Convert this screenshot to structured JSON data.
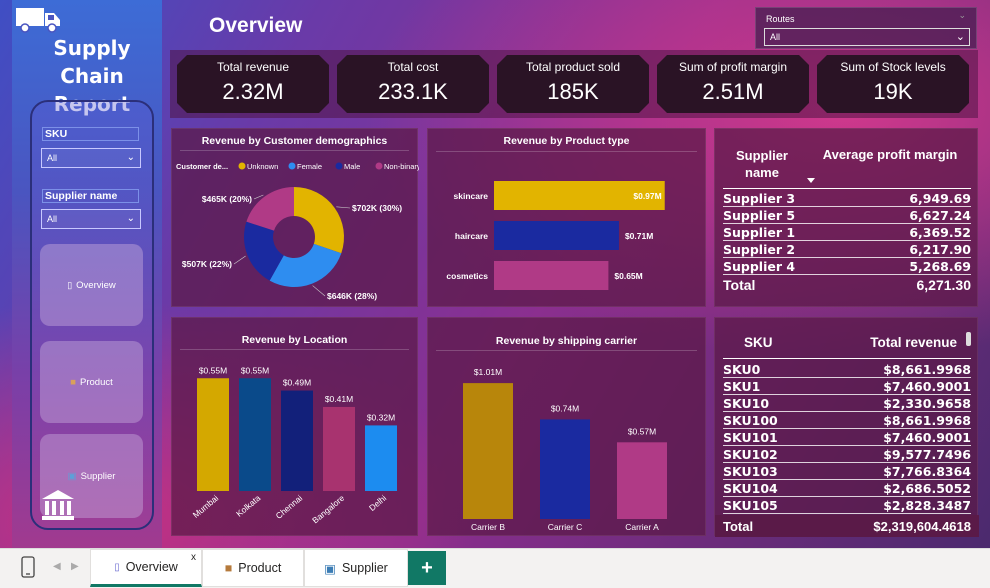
{
  "report": {
    "title_line1": "Supply Chain",
    "title_line2": "Report",
    "page_title": "Overview"
  },
  "slicers": {
    "sku": {
      "label": "SKU",
      "value": "All"
    },
    "supplier": {
      "label": "Supplier name",
      "value": "All"
    },
    "routes": {
      "label": "Routes",
      "value": "All"
    }
  },
  "nav": {
    "overview": "Overview",
    "product": "Product",
    "supplier": "Supplier"
  },
  "kpis": [
    {
      "title": "Total revenue",
      "value": "2.32M"
    },
    {
      "title": "Total cost",
      "value": "233.1K"
    },
    {
      "title": "Total product sold",
      "value": "185K"
    },
    {
      "title": "Sum of profit margin",
      "value": "2.51M"
    },
    {
      "title": "Sum of Stock levels",
      "value": "19K"
    }
  ],
  "chart_data": [
    {
      "type": "pie",
      "title": "Revenue by Customer demographics",
      "legend_title": "Customer de...",
      "legend_position": "top",
      "slices": [
        {
          "name": "Unknown",
          "value": 702,
          "label": "$702K (30%)",
          "color": "#e2b400"
        },
        {
          "name": "Female",
          "value": 646,
          "label": "$646K (28%)",
          "color": "#2e8df0"
        },
        {
          "name": "Male",
          "value": 507,
          "label": "$507K (22%)",
          "color": "#1a2aa0"
        },
        {
          "name": "Non-binary",
          "value": 465,
          "label": "$465K (20%)",
          "color": "#b03a86"
        }
      ]
    },
    {
      "type": "bar",
      "orientation": "horizontal",
      "title": "Revenue by Product type",
      "categories": [
        "skincare",
        "haircare",
        "cosmetics"
      ],
      "values": [
        0.97,
        0.71,
        0.65
      ],
      "value_labels": [
        "$0.97M",
        "$0.71M",
        "$0.65M"
      ],
      "colors": [
        "#e2b400",
        "#1a2aa0",
        "#b03a86"
      ],
      "xlim": [
        0,
        1.0
      ]
    },
    {
      "type": "bar",
      "title": "Revenue by Location",
      "categories": [
        "Mumbai",
        "Kolkata",
        "Chennai",
        "Bangalore",
        "Delhi"
      ],
      "values": [
        0.55,
        0.55,
        0.49,
        0.41,
        0.32
      ],
      "value_labels": [
        "$0.55M",
        "$0.55M",
        "$0.49M",
        "$0.41M",
        "$0.32M"
      ],
      "colors": [
        "#d4a800",
        "#0a4a8a",
        "#12207a",
        "#a8336f",
        "#1c8cf0"
      ],
      "ylim": [
        0,
        0.6
      ]
    },
    {
      "type": "bar",
      "title": "Revenue by shipping carrier",
      "categories": [
        "Carrier B",
        "Carrier C",
        "Carrier A"
      ],
      "values": [
        1.01,
        0.74,
        0.57
      ],
      "value_labels": [
        "$1.01M",
        "$0.74M",
        "$0.57M"
      ],
      "colors": [
        "#b8860b",
        "#1a2aa0",
        "#b03a86"
      ],
      "ylim": [
        0,
        1.1
      ]
    }
  ],
  "supplier_table": {
    "col1": "Supplier name",
    "col2": "Average profit margin",
    "rows": [
      {
        "name": "Supplier 3",
        "value": "6,949.69"
      },
      {
        "name": "Supplier 5",
        "value": "6,627.24"
      },
      {
        "name": "Supplier 1",
        "value": "6,369.52"
      },
      {
        "name": "Supplier 2",
        "value": "6,217.90"
      },
      {
        "name": "Supplier 4",
        "value": "5,268.69"
      }
    ],
    "total_label": "Total",
    "total_value": "6,271.30"
  },
  "sku_table": {
    "col1": "SKU",
    "col2": "Total revenue",
    "rows": [
      {
        "name": "SKU0",
        "value": "$8,661.9968"
      },
      {
        "name": "SKU1",
        "value": "$7,460.9001"
      },
      {
        "name": "SKU10",
        "value": "$2,330.9658"
      },
      {
        "name": "SKU100",
        "value": "$8,661.9968"
      },
      {
        "name": "SKU101",
        "value": "$7,460.9001"
      },
      {
        "name": "SKU102",
        "value": "$9,577.7496"
      },
      {
        "name": "SKU103",
        "value": "$7,766.8364"
      },
      {
        "name": "SKU104",
        "value": "$2,686.5052"
      },
      {
        "name": "SKU105",
        "value": "$2,828.3487"
      }
    ],
    "total_label": "Total",
    "total_value": "$2,319,604.4618"
  },
  "tabs": [
    {
      "label": "Overview",
      "icon": "person-icon"
    },
    {
      "label": "Product",
      "icon": "box-icon"
    },
    {
      "label": "Supplier",
      "icon": "truck-icon"
    }
  ],
  "tab_close": "x",
  "tab_add": "+"
}
